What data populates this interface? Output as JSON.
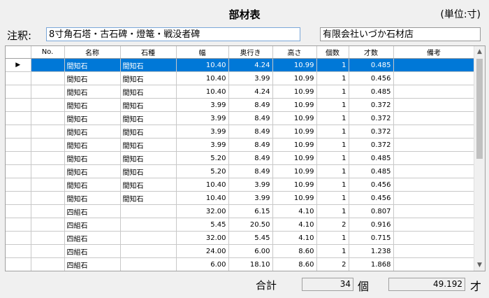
{
  "header": {
    "title": "部材表",
    "unit": "(単位:寸)",
    "note_label": "注釈:",
    "note_value": "8寸角石塔・古石碑・燈篭・戦没者碑",
    "company": "有限会社いづか石材店"
  },
  "table": {
    "columns": [
      "No.",
      "名称",
      "石種",
      "幅",
      "奥行き",
      "高さ",
      "個数",
      "才数",
      "備考"
    ],
    "selected_row_marker": "▶",
    "rows": [
      {
        "no": "",
        "name": "間知石",
        "stone": "間知石",
        "w": "10.40",
        "d": "4.24",
        "h": "10.99",
        "qty": "1",
        "sai": "0.485",
        "note": ""
      },
      {
        "no": "",
        "name": "間知石",
        "stone": "間知石",
        "w": "10.40",
        "d": "3.99",
        "h": "10.99",
        "qty": "1",
        "sai": "0.456",
        "note": ""
      },
      {
        "no": "",
        "name": "間知石",
        "stone": "間知石",
        "w": "10.40",
        "d": "4.24",
        "h": "10.99",
        "qty": "1",
        "sai": "0.485",
        "note": ""
      },
      {
        "no": "",
        "name": "間知石",
        "stone": "間知石",
        "w": "3.99",
        "d": "8.49",
        "h": "10.99",
        "qty": "1",
        "sai": "0.372",
        "note": ""
      },
      {
        "no": "",
        "name": "間知石",
        "stone": "間知石",
        "w": "3.99",
        "d": "8.49",
        "h": "10.99",
        "qty": "1",
        "sai": "0.372",
        "note": ""
      },
      {
        "no": "",
        "name": "間知石",
        "stone": "間知石",
        "w": "3.99",
        "d": "8.49",
        "h": "10.99",
        "qty": "1",
        "sai": "0.372",
        "note": ""
      },
      {
        "no": "",
        "name": "間知石",
        "stone": "間知石",
        "w": "3.99",
        "d": "8.49",
        "h": "10.99",
        "qty": "1",
        "sai": "0.372",
        "note": ""
      },
      {
        "no": "",
        "name": "間知石",
        "stone": "間知石",
        "w": "5.20",
        "d": "8.49",
        "h": "10.99",
        "qty": "1",
        "sai": "0.485",
        "note": ""
      },
      {
        "no": "",
        "name": "間知石",
        "stone": "間知石",
        "w": "5.20",
        "d": "8.49",
        "h": "10.99",
        "qty": "1",
        "sai": "0.485",
        "note": ""
      },
      {
        "no": "",
        "name": "間知石",
        "stone": "間知石",
        "w": "10.40",
        "d": "3.99",
        "h": "10.99",
        "qty": "1",
        "sai": "0.456",
        "note": ""
      },
      {
        "no": "",
        "name": "間知石",
        "stone": "間知石",
        "w": "10.40",
        "d": "3.99",
        "h": "10.99",
        "qty": "1",
        "sai": "0.456",
        "note": ""
      },
      {
        "no": "",
        "name": "四組石",
        "stone": "",
        "w": "32.00",
        "d": "6.15",
        "h": "4.10",
        "qty": "1",
        "sai": "0.807",
        "note": ""
      },
      {
        "no": "",
        "name": "四組石",
        "stone": "",
        "w": "5.45",
        "d": "20.50",
        "h": "4.10",
        "qty": "2",
        "sai": "0.916",
        "note": ""
      },
      {
        "no": "",
        "name": "四組石",
        "stone": "",
        "w": "32.00",
        "d": "5.45",
        "h": "4.10",
        "qty": "1",
        "sai": "0.715",
        "note": ""
      },
      {
        "no": "",
        "name": "四組石",
        "stone": "",
        "w": "24.00",
        "d": "6.00",
        "h": "8.60",
        "qty": "1",
        "sai": "1.238",
        "note": ""
      },
      {
        "no": "",
        "name": "四組石",
        "stone": "",
        "w": "6.00",
        "d": "18.10",
        "h": "8.60",
        "qty": "2",
        "sai": "1.868",
        "note": ""
      }
    ]
  },
  "scroll": {
    "up_icon": "▲",
    "down_icon": "▼"
  },
  "footer": {
    "total_label": "合計",
    "count_total": "34",
    "count_unit": "個",
    "sai_total": "49.192",
    "sai_unit": "才"
  }
}
